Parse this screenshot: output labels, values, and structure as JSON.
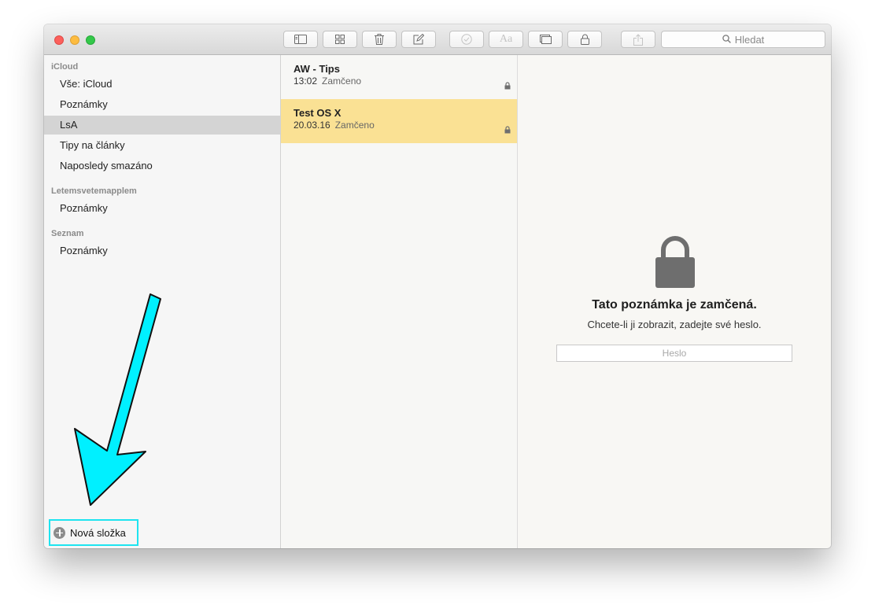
{
  "toolbar": {
    "buttons": [
      {
        "icon": "sidebar-toggle-icon"
      },
      {
        "icon": "grid-icon"
      },
      {
        "icon": "trash-icon"
      },
      {
        "icon": "compose-icon"
      },
      {
        "icon": "checklist-icon"
      },
      {
        "icon": "format-icon",
        "label": "Aa"
      },
      {
        "icon": "media-icon"
      },
      {
        "icon": "lock-icon"
      },
      {
        "icon": "share-icon"
      }
    ],
    "search_placeholder": "Hledat"
  },
  "sidebar": {
    "sections": [
      {
        "header": "iCloud",
        "items": [
          {
            "label": "Vše: iCloud"
          },
          {
            "label": "Poznámky"
          },
          {
            "label": "LsA",
            "selected": true
          },
          {
            "label": "Tipy na články"
          },
          {
            "label": "Naposledy smazáno"
          }
        ]
      },
      {
        "header": "Letemsvetemapplem",
        "items": [
          {
            "label": "Poznámky"
          }
        ]
      },
      {
        "header": "Seznam",
        "items": [
          {
            "label": "Poznámky"
          }
        ]
      }
    ],
    "new_folder_label": "Nová složka"
  },
  "notes": [
    {
      "title": "AW - Tips",
      "time": "13:02",
      "status": "Zamčeno",
      "locked": true
    },
    {
      "title": "Test OS X",
      "time": "20.03.16",
      "status": "Zamčeno",
      "locked": true,
      "selected": true
    }
  ],
  "detail": {
    "locked_title": "Tato poznámka je zamčená.",
    "locked_subtitle": "Chcete-li ji zobrazit, zadejte své heslo.",
    "password_placeholder": "Heslo"
  },
  "colors": {
    "selected_note": "#fae194",
    "annotation_arrow": "#00f0ff",
    "annotation_box": "#1ee4f0"
  }
}
